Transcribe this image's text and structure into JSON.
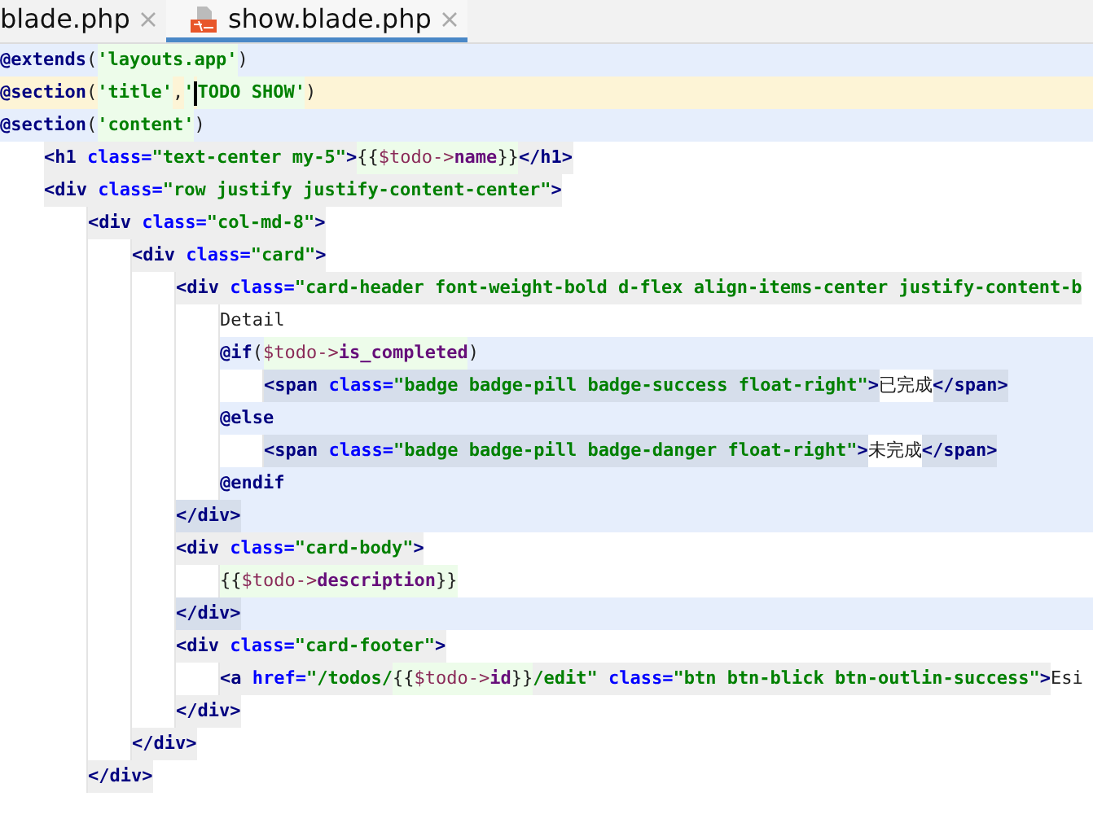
{
  "tabs": [
    {
      "label": "blade.php",
      "selected": false,
      "kind": "plain"
    },
    {
      "label": "show.blade.php",
      "selected": true,
      "kind": "blade"
    }
  ],
  "lines": [
    {
      "highlighted": true,
      "current": false,
      "tokens": [
        {
          "kind": "directive",
          "text": "@extends"
        },
        {
          "kind": "punct",
          "text": "("
        },
        {
          "kind": "bstr",
          "text": "'layouts.app'"
        },
        {
          "kind": "punct",
          "text": ")"
        }
      ]
    },
    {
      "highlighted": false,
      "current": true,
      "tokens": [
        {
          "kind": "directive",
          "text": "@section"
        },
        {
          "kind": "punct",
          "text": "("
        },
        {
          "kind": "bstr",
          "text": "'title'"
        },
        {
          "kind": "punct",
          "text": ","
        },
        {
          "kind": "bstr",
          "text": "'"
        },
        {
          "kind": "bstr",
          "text": "TODO SHOW'",
          "caret": true
        },
        {
          "kind": "punct",
          "text": ")"
        }
      ]
    },
    {
      "highlighted": true,
      "current": false,
      "tokens": [
        {
          "kind": "directive",
          "text": "@section"
        },
        {
          "kind": "punct",
          "text": "("
        },
        {
          "kind": "bstr",
          "text": "'content'"
        },
        {
          "kind": "punct",
          "text": ")"
        }
      ],
      "children": [
        {
          "highlighted": false,
          "current": false,
          "tokens": [
            {
              "kind": "tag",
              "text": "<h1"
            },
            {
              "kind": "attr",
              "text": " class="
            },
            {
              "kind": "str",
              "text": "\"text-center my-5\""
            },
            {
              "kind": "tag",
              "text": ">"
            },
            {
              "kind": "brace",
              "text": "{{"
            },
            {
              "kind": "var",
              "text": "$todo->"
            },
            {
              "kind": "prop",
              "text": "name"
            },
            {
              "kind": "brace",
              "text": "}}"
            },
            {
              "kind": "tag",
              "text": "</h1>"
            }
          ]
        },
        {
          "highlighted": false,
          "current": false,
          "tokens": [
            {
              "kind": "tag",
              "text": "<div"
            },
            {
              "kind": "attr",
              "text": " class="
            },
            {
              "kind": "str",
              "text": "\"row justify justify-content-center\""
            },
            {
              "kind": "tag",
              "text": ">"
            }
          ],
          "children": [
            {
              "highlighted": false,
              "current": false,
              "tokens": [
                {
                  "kind": "tag",
                  "text": "<div"
                },
                {
                  "kind": "attr",
                  "text": " class="
                },
                {
                  "kind": "str",
                  "text": "\"col-md-8\""
                },
                {
                  "kind": "tag",
                  "text": ">"
                }
              ],
              "children": [
                {
                  "highlighted": false,
                  "current": false,
                  "tokens": [
                    {
                      "kind": "tag",
                      "text": "<div"
                    },
                    {
                      "kind": "attr",
                      "text": " class="
                    },
                    {
                      "kind": "str",
                      "text": "\"card\""
                    },
                    {
                      "kind": "tag",
                      "text": ">"
                    }
                  ],
                  "children": [
                    {
                      "highlighted": false,
                      "current": false,
                      "tokens": [
                        {
                          "kind": "tag",
                          "text": "<div"
                        },
                        {
                          "kind": "attr",
                          "text": " class="
                        },
                        {
                          "kind": "str",
                          "text": "\"card-header font-weight-bold d-flex align-items-center justify-content-b"
                        }
                      ],
                      "children": [
                        {
                          "highlighted": false,
                          "current": false,
                          "tokens": [
                            {
                              "kind": "text",
                              "text": "Detail"
                            }
                          ]
                        },
                        {
                          "highlighted": true,
                          "current": false,
                          "tokens": [
                            {
                              "kind": "directive",
                              "text": "@if"
                            },
                            {
                              "kind": "punct",
                              "text": "("
                            },
                            {
                              "kind": "var",
                              "text": "$todo->"
                            },
                            {
                              "kind": "prop",
                              "text": "is_completed"
                            },
                            {
                              "kind": "punct",
                              "text": ")"
                            }
                          ],
                          "children": [
                            {
                              "highlighted": true,
                              "current": false,
                              "tokens": [
                                {
                                  "kind": "tag",
                                  "text": "<span"
                                },
                                {
                                  "kind": "attr",
                                  "text": " class="
                                },
                                {
                                  "kind": "str",
                                  "text": "\"badge badge-pill badge-success float-right\""
                                },
                                {
                                  "kind": "tag",
                                  "text": ">"
                                },
                                {
                                  "kind": "text",
                                  "text": "已完成"
                                },
                                {
                                  "kind": "tag",
                                  "text": "</span>"
                                }
                              ]
                            }
                          ]
                        },
                        {
                          "highlighted": true,
                          "current": false,
                          "tokens": [
                            {
                              "kind": "directive",
                              "text": "@else"
                            }
                          ],
                          "children": [
                            {
                              "highlighted": true,
                              "current": false,
                              "tokens": [
                                {
                                  "kind": "tag",
                                  "text": "<span"
                                },
                                {
                                  "kind": "attr",
                                  "text": " class="
                                },
                                {
                                  "kind": "str",
                                  "text": "\"badge badge-pill badge-danger float-right\""
                                },
                                {
                                  "kind": "tag",
                                  "text": ">"
                                },
                                {
                                  "kind": "text",
                                  "text": "未完成"
                                },
                                {
                                  "kind": "tag",
                                  "text": "</span>"
                                }
                              ]
                            }
                          ]
                        },
                        {
                          "highlighted": true,
                          "current": false,
                          "tokens": [
                            {
                              "kind": "directive",
                              "text": "@endif"
                            }
                          ]
                        }
                      ]
                    },
                    {
                      "highlighted": true,
                      "current": false,
                      "tokens": [
                        {
                          "kind": "tag",
                          "text": "</div>"
                        }
                      ]
                    },
                    {
                      "highlighted": false,
                      "current": false,
                      "tokens": [
                        {
                          "kind": "tag",
                          "text": "<div"
                        },
                        {
                          "kind": "attr",
                          "text": " class="
                        },
                        {
                          "kind": "str",
                          "text": "\"card-body\""
                        },
                        {
                          "kind": "tag",
                          "text": ">"
                        }
                      ],
                      "children": [
                        {
                          "highlighted": false,
                          "current": false,
                          "tokens": [
                            {
                              "kind": "brace",
                              "text": "{{"
                            },
                            {
                              "kind": "var",
                              "text": "$todo->"
                            },
                            {
                              "kind": "prop",
                              "text": "description"
                            },
                            {
                              "kind": "brace",
                              "text": "}}"
                            }
                          ]
                        }
                      ]
                    },
                    {
                      "highlighted": true,
                      "current": false,
                      "tokens": [
                        {
                          "kind": "tag",
                          "text": "</div>"
                        }
                      ]
                    },
                    {
                      "highlighted": false,
                      "current": false,
                      "tokens": [
                        {
                          "kind": "tag",
                          "text": "<div"
                        },
                        {
                          "kind": "attr",
                          "text": " class="
                        },
                        {
                          "kind": "str",
                          "text": "\"card-footer\""
                        },
                        {
                          "kind": "tag",
                          "text": ">"
                        }
                      ],
                      "children": [
                        {
                          "highlighted": false,
                          "current": false,
                          "tokens": [
                            {
                              "kind": "tag",
                              "text": "<a"
                            },
                            {
                              "kind": "attr",
                              "text": " href="
                            },
                            {
                              "kind": "str",
                              "text": "\"/todos/"
                            },
                            {
                              "kind": "brace",
                              "text": "{{"
                            },
                            {
                              "kind": "var",
                              "text": "$todo->"
                            },
                            {
                              "kind": "prop",
                              "text": "id"
                            },
                            {
                              "kind": "brace",
                              "text": "}}"
                            },
                            {
                              "kind": "str",
                              "text": "/edit\""
                            },
                            {
                              "kind": "attr",
                              "text": " class="
                            },
                            {
                              "kind": "str",
                              "text": "\"btn btn-blick btn-outlin-success\""
                            },
                            {
                              "kind": "tag",
                              "text": ">"
                            },
                            {
                              "kind": "text",
                              "text": "Esi"
                            }
                          ]
                        }
                      ]
                    },
                    {
                      "highlighted": false,
                      "current": false,
                      "tokens": [
                        {
                          "kind": "tag",
                          "text": "</div>"
                        }
                      ]
                    }
                  ]
                },
                {
                  "highlighted": false,
                  "current": false,
                  "tokens": [
                    {
                      "kind": "tag",
                      "text": "</div>"
                    }
                  ]
                }
              ]
            },
            {
              "highlighted": false,
              "current": false,
              "tokens": [
                {
                  "kind": "tag",
                  "text": "</div>"
                }
              ]
            }
          ]
        }
      ]
    }
  ]
}
